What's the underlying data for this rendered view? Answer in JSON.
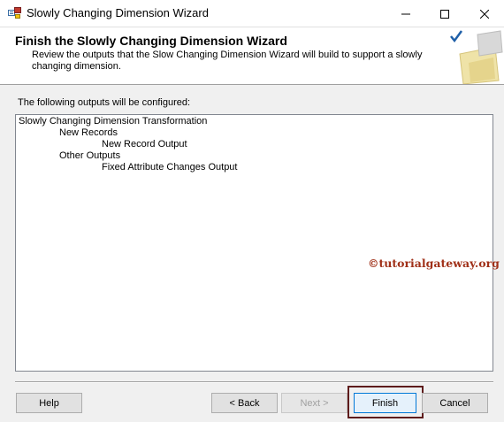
{
  "window": {
    "title": "Slowly Changing Dimension Wizard",
    "icon": "wizard-app-icon"
  },
  "header": {
    "title": "Finish the Slowly Changing Dimension Wizard",
    "description": "Review the outputs that the Slow Changing Dimension Wizard will build to support a slowly changing dimension."
  },
  "main": {
    "label": "The following outputs will be configured:",
    "tree": [
      {
        "level": 0,
        "text": "Slowly Changing Dimension Transformation"
      },
      {
        "level": 1,
        "text": "New Records"
      },
      {
        "level": 2,
        "text": "New Record Output"
      },
      {
        "level": 1,
        "text": "Other Outputs"
      },
      {
        "level": 2,
        "text": "Fixed Attribute Changes Output"
      }
    ]
  },
  "watermark": "©tutorialgateway.org",
  "buttons": {
    "help": "Help",
    "back": "< Back",
    "next": "Next >",
    "finish": "Finish",
    "cancel": "Cancel"
  },
  "colors": {
    "highlight_border": "#5e1c1c",
    "watermark": "#a03018",
    "focus_border": "#0078d7"
  }
}
